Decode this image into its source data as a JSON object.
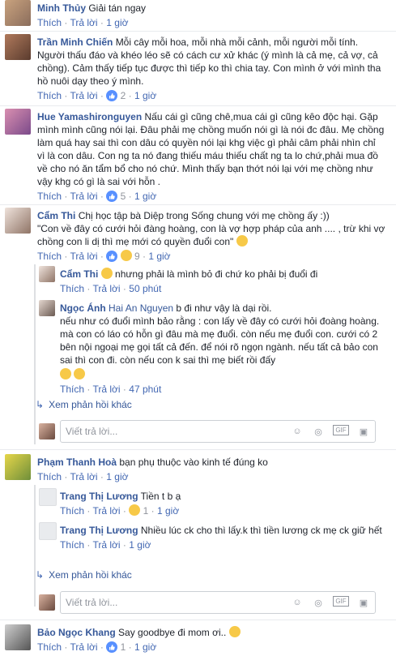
{
  "actions": {
    "like": "Thích",
    "reply": "Trả lời",
    "dot": "·"
  },
  "comments": [
    {
      "name": "Minh Thủy",
      "text": "Giải tán ngay",
      "time": "1 giờ"
    },
    {
      "name": "Trần Minh Chiến",
      "text": "Mỗi cây mỗi hoa, mỗi nhà mỗi cảnh, mỗi người mỗi tính. Người thấu đáo và khéo léo sẽ có cách cư xử khác (ý mình là cả mẹ, cả vợ, cả chồng). Cảm thấy tiếp tục được thì tiếp ko thì chia tay. Con mình ở với mình tha hồ nuôi dạy theo ý mình.",
      "likes": "2",
      "time": "1 giờ"
    },
    {
      "name": "Hue Yamashironguyen",
      "text": "Nấu cái gì cũng chê,mua cái gì cũng kêo độc hại. Gặp mình mình cũng nói lại. Đâu phải mẹ chồng muốn nói gì là nói đc đâu. Mẹ chồng làm quá hay sai thì con dâu có quyền nói lại khg việc gì phải câm phải nhìn chỉ vì là con dâu. Con ng ta nó đang thiếu máu thiếu chất ng ta lo chứ,phải mua đồ về cho nó ăn tẩm bổ cho nó chứ. Mình thấy bạn thớt nói lại với mẹ chồng như vậy khg có gì là sai với hỗn .",
      "likes": "5",
      "time": "1 giờ"
    },
    {
      "name": "Cẩm Thi",
      "text": "Chị học tập bà Diệp trong Sống chung với mẹ chồng ấy :))",
      "text2": "\"Con về đây có cưới hỏi đàng hoàng, con là vợ hợp pháp của anh .... , trừ khi vợ chồng con li dị thì mẹ mới có quyền đuổi con\"",
      "likes": "9",
      "time": "1 giờ",
      "replies": [
        {
          "name": "Cẩm Thi",
          "text": "nhưng phải là mình bỏ đi chứ ko phải bị đuổi đi",
          "time": "50 phút"
        },
        {
          "name": "Ngọc Ánh",
          "tag": "Hai An Nguyen",
          "text": "b đi như vậy là dại rồi.",
          "text2": "nếu như có đuổi mình bảo rằng : con lấy về đây có cưới hỏi đoàng hoàng. mà con có láo có hỗn gì đâu mà mẹ đuổi. còn nếu mẹ đuổi con. cưới có 2 bên nội ngoại mẹ gọi tất cả đến. để nói rõ ngọn ngành. nếu tất cả bảo con sai thì con đi. còn nếu con k sai thì mẹ biết rồi đấy",
          "time": "47 phút"
        }
      ],
      "more": "Xem phản hồi khác",
      "reply_placeholder": "Viết trả lời..."
    },
    {
      "name": "Phạm Thanh Hoà",
      "text": "bạn phụ thuộc vào kinh tế đúng ko",
      "time": "1 giờ",
      "replies": [
        {
          "name": "Trang Thị Lương",
          "text": "Tiền t b ạ",
          "likes": "1",
          "time": "1 giờ"
        },
        {
          "name": "Trang Thị Lương",
          "text": "Nhiều lúc ck cho thì lấy.k thì tiền lương ck mẹ ck giữ hết",
          "time": "1 giờ"
        }
      ],
      "more": "Xem phản hồi khác",
      "reply_placeholder": "Viết trả lời..."
    },
    {
      "name": "Bảo Ngọc Khang",
      "text": "Say goodbye đi mom ơi..",
      "likes": "1",
      "time": "1 giờ"
    }
  ],
  "tools": [
    "emoji-icon",
    "camera-icon",
    "gif-icon",
    "sticker-icon"
  ],
  "colors": {
    "link": "#365899",
    "action": "#4267b2",
    "meta": "#90949c",
    "like": "#5890ff"
  }
}
